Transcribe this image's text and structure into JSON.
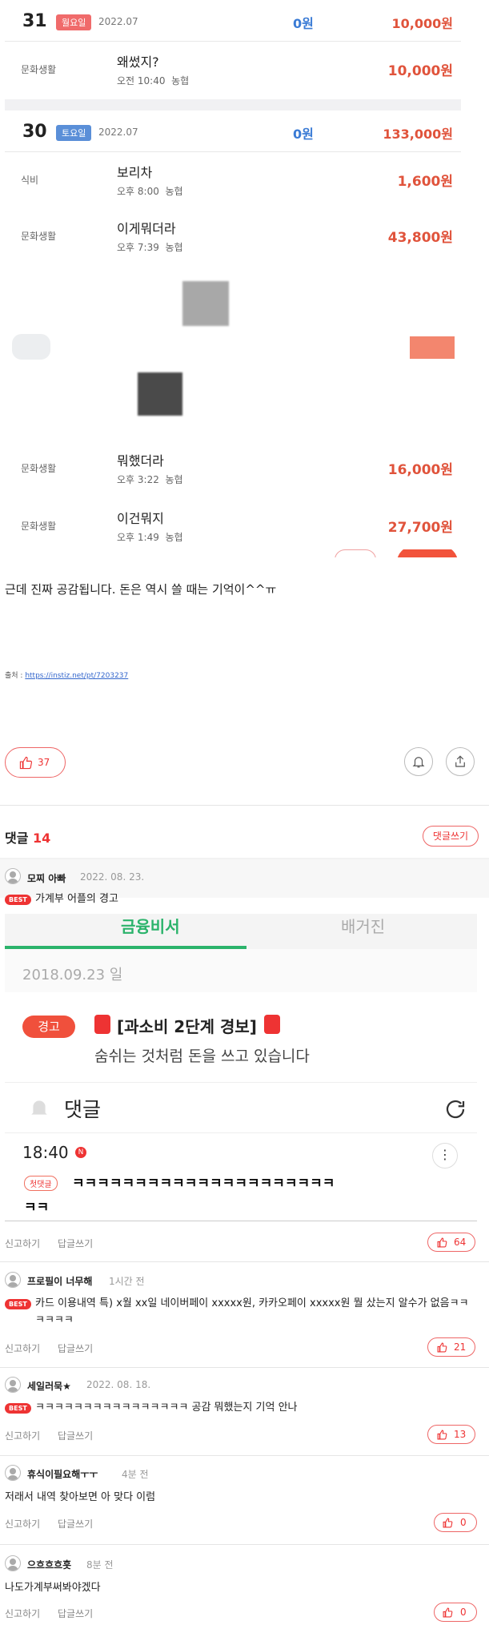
{
  "ledger": {
    "day1": {
      "num": "31",
      "weekday": "월요일",
      "date": "2022.07",
      "income": "0원",
      "expense": "10,000원"
    },
    "day1_rows": [
      {
        "category": "문화생활",
        "title": "왜썼지?",
        "time": "오전 10:40",
        "bank": "농협",
        "amount": "10,000원"
      }
    ],
    "day2": {
      "num": "30",
      "weekday": "토요일",
      "date": "2022.07",
      "income": "0원",
      "expense": "133,000원"
    },
    "day2_rows": [
      {
        "category": "식비",
        "title": "보리차",
        "time": "오후 8:00",
        "bank": "농협",
        "amount": "1,600원"
      },
      {
        "category": "문화생활",
        "title": "이게뭐더라",
        "time": "오후 7:39",
        "bank": "농협",
        "amount": "43,800원"
      },
      {
        "category": "문화생활",
        "title": "뭐했더라",
        "time": "오후 3:22",
        "bank": "농협",
        "amount": "16,000원"
      },
      {
        "category": "문화생활",
        "title": "이건뭐지",
        "time": "오후 1:49",
        "bank": "농협",
        "amount": "27,700원"
      }
    ],
    "colors": {
      "weekday_badge": "#f06b6b",
      "saturday_badge": "#5a8fd8",
      "income": "#3a7bd5",
      "expense": "#e0533b"
    }
  },
  "post": {
    "text": "근데 진짜 공감됩니다. 돈은 역시 쓸 때는 기억이^^ㅠ",
    "source_label": "출처 : ",
    "source_url": "https://instiz.net/pt/7203237",
    "like_count": "37",
    "icons": [
      "thumbs-up-icon",
      "bell-icon",
      "share-icon"
    ]
  },
  "comments_header": {
    "title": "댓글",
    "count": "14",
    "write_label": "댓글쓰기"
  },
  "comments": [
    {
      "name": "모찌 아빠",
      "time": "2022. 08. 23.",
      "best": "BEST",
      "body": "가계부 어플의 경고",
      "report": "신고하기",
      "reply": "답글쓰기",
      "votes": "64"
    },
    {
      "name": "프로필이 너무해",
      "time": "1시간 전",
      "best": "BEST",
      "body": "카드 이용내역 특) x월 xx일 네이버페이 xxxxx원, 카카오페이 xxxxx원 뭘 샀는지 알수가 없음ㅋㅋㅋㅋㅋㅋ",
      "report": "신고하기",
      "reply": "답글쓰기",
      "votes": "21"
    },
    {
      "name": "세일러묵★",
      "time": "2022. 08. 18.",
      "best": "BEST",
      "body": "ㅋㅋㅋㅋㅋㅋㅋㅋㅋㅋㅋㅋㅋㅋㅋㅋ 공감 뭐했는지 기억 안나",
      "report": "신고하기",
      "reply": "답글쓰기",
      "votes": "13"
    },
    {
      "name": "휴식이필요해ㅜㅜ",
      "time": "4분 전",
      "body": "저래서 내역 찾아보면 아 맞다 이럼",
      "report": "신고하기",
      "reply": "답글쓰기",
      "votes": "0"
    },
    {
      "name": "으흐흐흐흣",
      "time": "8분 전",
      "body": "나도가계부써봐야겠다",
      "report": "신고하기",
      "reply": "답글쓰기",
      "votes": "0"
    }
  ],
  "embedded": {
    "tab_left": "금융비서",
    "tab_right": "배거진",
    "date": "2018.09.23 일",
    "warn_badge": "경고",
    "warn_title": "[과소비 2단계 경보]",
    "warn_msg": "숨쉬는 것처럼 돈을 쓰고 있습니다",
    "comment_label": "댓글",
    "time": "18:40",
    "new_badge": "N",
    "first_badge": "첫댓글",
    "laugh_line1": "ㅋㅋㅋㅋㅋㅋㅋㅋㅋㅋㅋㅋㅋㅋㅋㅋㅋㅋㅋㅋㅋ",
    "laugh_line2": "ㅋㅋ",
    "accent": "#2bb36b"
  }
}
